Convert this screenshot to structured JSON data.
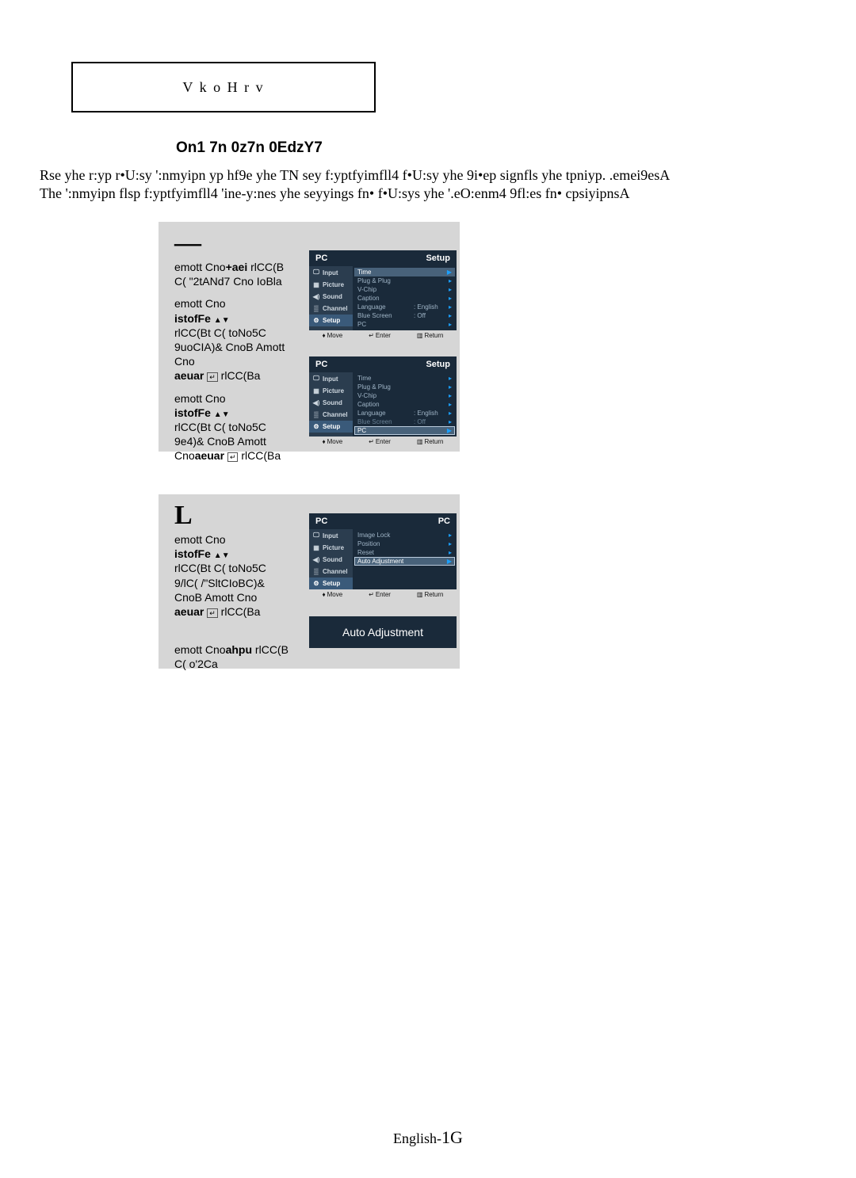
{
  "notes_label": "V k o H r v",
  "section_title": "On1 7n 0z7n 0EdzY7",
  "body_text": "Rse yhe r:yp r•U:sy ':nmyipn yp hf9e yhe TN sey f:yptfyimfll4 f•U:sy yhe 9i•ep signfls yhe tpniyp. .emei9esA The ':nmyipn flsp f:yptfyimfll4 'ine-y:nes yhe seyyings fn• f•U:sys yhe '.eO:enm4 9fl:es fn• cpsiyipnsA",
  "step1": {
    "number": "—",
    "line1a": "emott Cno",
    "line1b": "+aei",
    "line1c": "   rlCC(B",
    "line2": "C( \"2tANd7 Cno IoBla",
    "line3a": "emott Cno",
    "line4a": "istofFe     ",
    "line5": "rlCC(Bt C( toNo5C",
    "line6": "9uoCIA)& CnoB Amott Cno",
    "line7a": "aeuar   ",
    "line7b": "   rlCC(Ba",
    "line8": "emott Cno",
    "line9": "istofFe     ",
    "line10": "rlCC(Bt C( toNo5C",
    "line11": "9e4)& CnoB Amott",
    "line12a": "Cno",
    "line12b": "aeuar   ",
    "line12c": "   rlCC(Ba"
  },
  "step2": {
    "number": "L",
    "line1": "emott Cno",
    "line2": "istofFe     ",
    "line3": "rlCC(Bt C( toNo5C",
    "line4": "9/lC( /\"SltCIoBC)&",
    "line5": "CnoB Amott Cno",
    "line6a": "aeuar   ",
    "line6b": "   rlCC(Ba",
    "line7a": "emott Cno",
    "line7b": "ahpu",
    "line7c": " rlCC(B",
    "line8": "C(  o'2Ca"
  },
  "osd": {
    "tv_label": "PC",
    "setup_label": "Setup",
    "pc_label": "PC",
    "sidebar": [
      {
        "icon": "🖵",
        "label": "Input"
      },
      {
        "icon": "▦",
        "label": "Picture"
      },
      {
        "icon": "◀)",
        "label": "Sound"
      },
      {
        "icon": "▒",
        "label": "Channel"
      },
      {
        "icon": "⚙",
        "label": "Setup"
      }
    ],
    "setup_rows": [
      {
        "label": "Time",
        "val": "",
        "sel": true
      },
      {
        "label": "Plug & Plug",
        "val": ""
      },
      {
        "label": "V-Chip",
        "val": ""
      },
      {
        "label": "Caption",
        "val": ""
      },
      {
        "label": "Language",
        "val": ":   English"
      },
      {
        "label": "Blue Screen",
        "val": ":   Off"
      },
      {
        "label": "PC",
        "val": ""
      }
    ],
    "setup_rows2": [
      {
        "label": "Time",
        "val": ""
      },
      {
        "label": "Plug & Plug",
        "val": ""
      },
      {
        "label": "V-Chip",
        "val": ""
      },
      {
        "label": "Caption",
        "val": ""
      },
      {
        "label": "Language",
        "val": ":   English"
      },
      {
        "label": "Blue Screen",
        "val": ":   Off",
        "dim": true
      },
      {
        "label": "PC",
        "val": "",
        "selbox": true
      }
    ],
    "pc_rows": [
      {
        "label": "Image Lock",
        "val": ""
      },
      {
        "label": "Position",
        "val": ""
      },
      {
        "label": "Reset",
        "val": ""
      },
      {
        "label": "Auto Adjustment",
        "val": "",
        "selbox": true
      }
    ],
    "footer": {
      "move": "Move",
      "enter": "Enter",
      "return": "Return"
    },
    "auto_banner": "Auto Adjustment"
  },
  "page_footer_prefix": "English-",
  "page_footer_num": "1G"
}
